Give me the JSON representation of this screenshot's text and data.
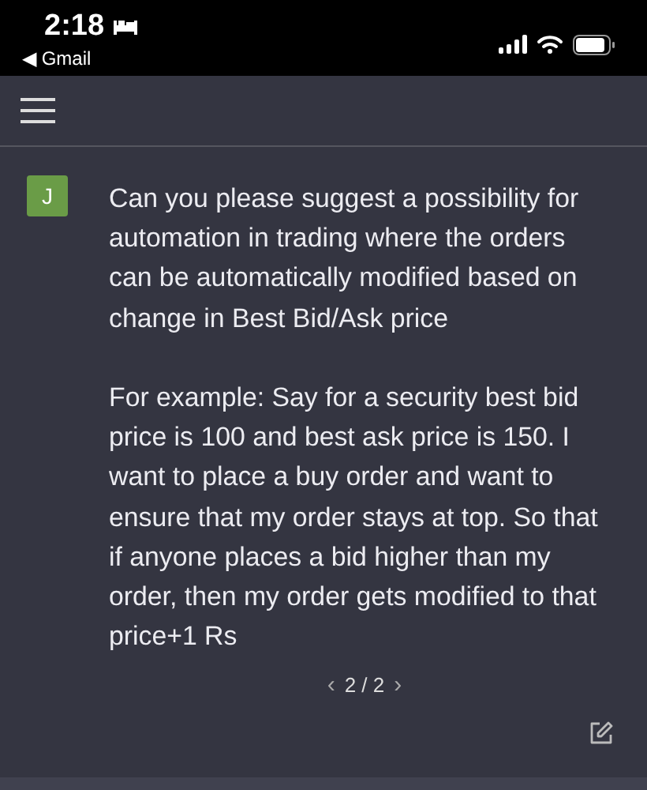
{
  "status_bar": {
    "time": "2:18",
    "back_app": "◀ Gmail"
  },
  "message": {
    "avatar": "J",
    "paragraphs": [
      "Can you please suggest a possibility for automation in trading where the orders can be automatically modified based on change in Best Bid/Ask price",
      "For example: Say for a security best bid price is 100 and best ask price is 150. I want to place a buy order and want to ensure that my order stays at top. So that if anyone places a bid higher than my order, then my order gets modified to that price+1 Rs"
    ]
  },
  "pager": {
    "prev": "‹",
    "label": "2 / 2",
    "next": "›"
  }
}
